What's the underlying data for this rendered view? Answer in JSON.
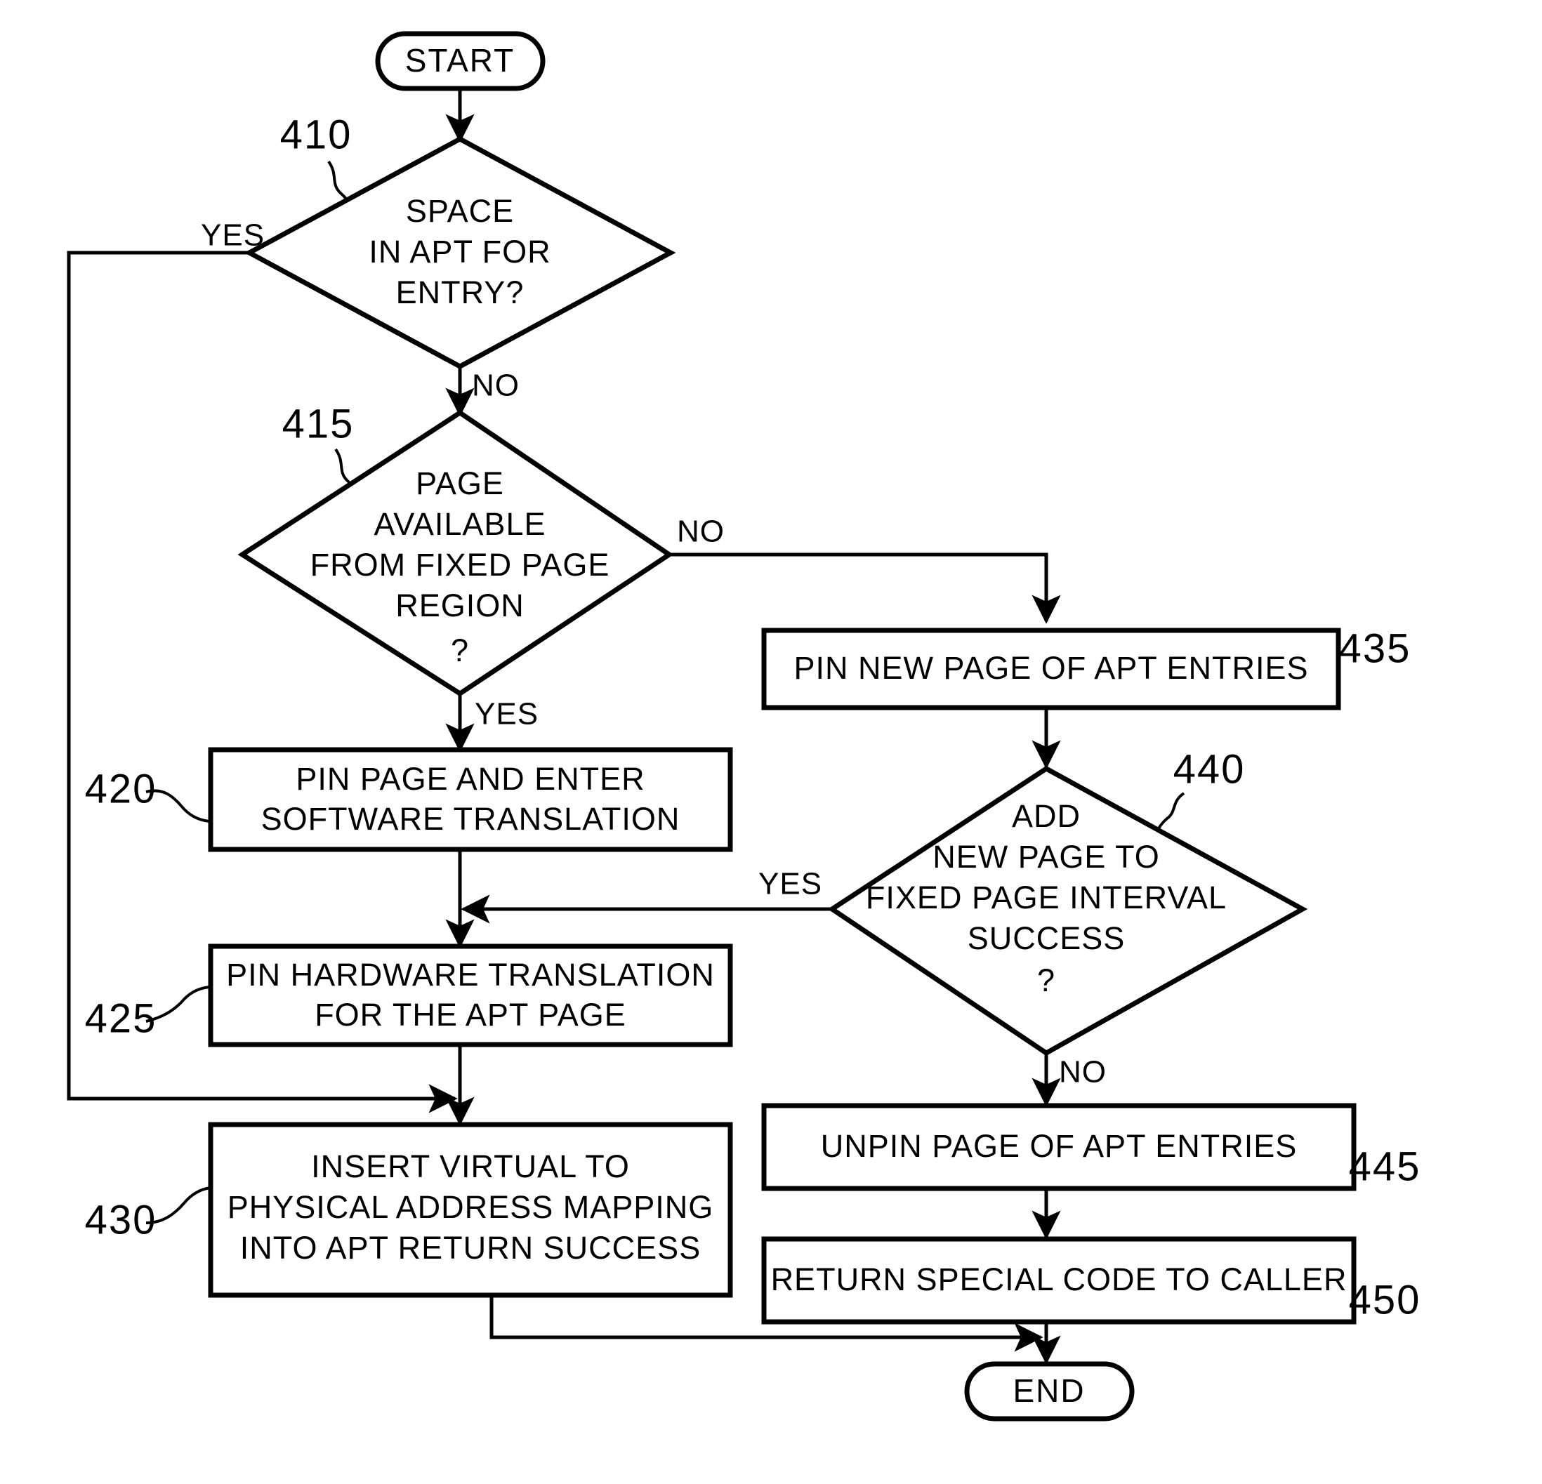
{
  "figure": {
    "type": "flowchart",
    "nodes": [
      {
        "id": "start",
        "shape": "terminal",
        "ref": "",
        "lines": [
          "START"
        ]
      },
      {
        "id": "d410",
        "shape": "decision",
        "ref": "410",
        "lines": [
          "SPACE",
          "IN APT FOR",
          "ENTRY?"
        ]
      },
      {
        "id": "d415",
        "shape": "decision",
        "ref": "415",
        "lines": [
          "PAGE",
          "AVAILABLE",
          "FROM FIXED PAGE",
          "REGION",
          "?"
        ]
      },
      {
        "id": "p420",
        "shape": "process",
        "ref": "420",
        "lines": [
          "PIN PAGE AND ENTER",
          "SOFTWARE TRANSLATION"
        ]
      },
      {
        "id": "p425",
        "shape": "process",
        "ref": "425",
        "lines": [
          "PIN HARDWARE TRANSLATION",
          "FOR THE APT PAGE"
        ]
      },
      {
        "id": "p430",
        "shape": "process",
        "ref": "430",
        "lines": [
          "INSERT VIRTUAL TO",
          "PHYSICAL ADDRESS MAPPING",
          "INTO APT RETURN SUCCESS"
        ]
      },
      {
        "id": "p435",
        "shape": "process",
        "ref": "435",
        "lines": [
          "PIN NEW PAGE OF APT ENTRIES"
        ]
      },
      {
        "id": "d440",
        "shape": "decision",
        "ref": "440",
        "lines": [
          "ADD",
          "NEW PAGE TO",
          "FIXED PAGE INTERVAL",
          "SUCCESS",
          "?"
        ]
      },
      {
        "id": "p445",
        "shape": "process",
        "ref": "445",
        "lines": [
          "UNPIN PAGE OF APT ENTRIES"
        ]
      },
      {
        "id": "p450",
        "shape": "process",
        "ref": "450",
        "lines": [
          "RETURN SPECIAL CODE TO CALLER"
        ]
      },
      {
        "id": "end",
        "shape": "terminal",
        "ref": "",
        "lines": [
          "END"
        ]
      }
    ],
    "edge_labels": {
      "yes_410": "YES",
      "no_410": "NO",
      "no_415": "NO",
      "yes_415": "YES",
      "yes_440": "YES",
      "no_440": "NO"
    },
    "reference_numerals": [
      "410",
      "415",
      "420",
      "425",
      "430",
      "435",
      "440",
      "445",
      "450"
    ],
    "colors": {
      "ink": "#000000",
      "paper": "#ffffff"
    }
  }
}
